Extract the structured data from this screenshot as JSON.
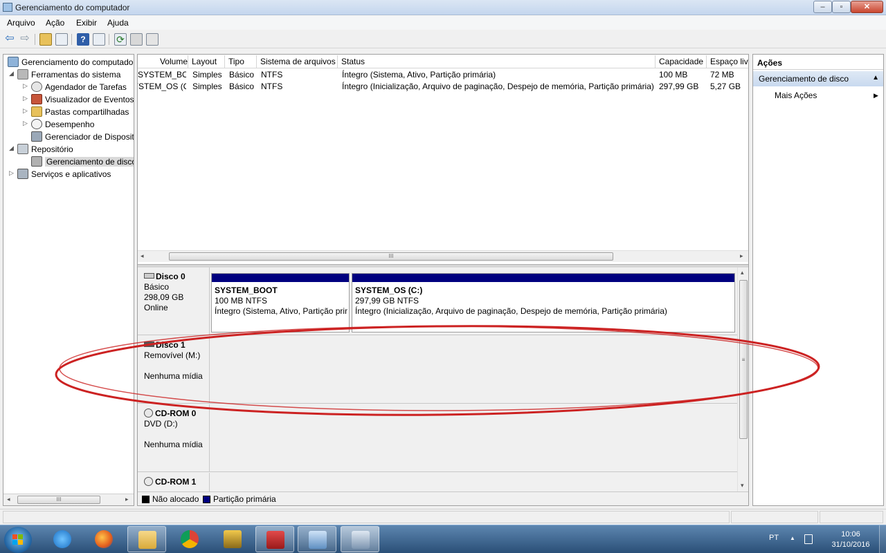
{
  "window": {
    "title": "Gerenciamento do computador",
    "minimize_glyph": "‒",
    "maximize_glyph": "▫",
    "close_glyph": "✕"
  },
  "menu": [
    "Arquivo",
    "Ação",
    "Exibir",
    "Ajuda"
  ],
  "toolbar": {
    "back_glyph": "⇦",
    "forward_glyph": "⇨",
    "help_glyph": "?",
    "refresh_glyph": "⟳"
  },
  "tree": {
    "root": "Gerenciamento do computador (Local)",
    "system_tools": "Ferramentas do sistema",
    "task_scheduler": "Agendador de Tarefas",
    "event_viewer": "Visualizador de Eventos",
    "shared_folders": "Pastas compartilhadas",
    "performance": "Desempenho",
    "device_manager": "Gerenciador de Dispositivos",
    "storage": "Repositório",
    "disk_management": "Gerenciamento de disco",
    "services_apps": "Serviços e aplicativos",
    "expanded_glyph": "◢",
    "collapsed_glyph": "▷"
  },
  "volume_list": {
    "columns": [
      "Volume",
      "Layout",
      "Tipo",
      "Sistema de arquivos",
      "Status",
      "Capacidade",
      "Espaço livre"
    ],
    "rows": [
      [
        "SYSTEM_BOOT",
        "Simples",
        "Básico",
        "NTFS",
        "Íntegro (Sistema, Ativo, Partição primária)",
        "100 MB",
        "72 MB"
      ],
      [
        "SYSTEM_OS (C:)",
        "Simples",
        "Básico",
        "NTFS",
        "Íntegro (Inicialização, Arquivo de paginação, Despejo de memória, Partição primária)",
        "297,99 GB",
        "5,27 GB"
      ]
    ]
  },
  "scroll": {
    "grip": "III",
    "vgrip": "≡",
    "left_arrow": "◂",
    "right_arrow": "▸",
    "up_arrow": "▴",
    "down_arrow": "▾"
  },
  "disks": [
    {
      "name": "Disco 0",
      "line1": "Básico",
      "line2": "298,09 GB",
      "line3": "Online",
      "partitions": [
        {
          "name": "SYSTEM_BOOT",
          "size": "100 MB NTFS",
          "status": "Íntegro (Sistema, Ativo, Partição primária)"
        },
        {
          "name": "SYSTEM_OS  (C:)",
          "size": "297,99 GB NTFS",
          "status": "Íntegro (Inicialização, Arquivo de paginação, Despejo de memória, Partição primária)"
        }
      ]
    },
    {
      "name": "Disco 1",
      "line1": "Removível (M:)",
      "line3": "Nenhuma mídia"
    },
    {
      "name": "CD-ROM 0",
      "line1": "DVD (D:)",
      "line3": "Nenhuma mídia"
    },
    {
      "name": "CD-ROM 1"
    }
  ],
  "legend": [
    {
      "label": "Não alocado",
      "color": "#000000"
    },
    {
      "label": "Partição primária",
      "color": "#00007f"
    }
  ],
  "actions": {
    "title": "Ações",
    "section": "Gerenciamento de disco",
    "section_arrow": "▲",
    "more": "Mais Ações",
    "more_arrow": "▶"
  },
  "annotation": {
    "color": "#cc2222"
  },
  "taskbar": {
    "language": "PT",
    "tray_arrow": "▲",
    "time": "10:06",
    "date": "31/10/2016",
    "apps": [
      "internet-explorer",
      "firefox",
      "file-explorer",
      "chrome",
      "tool-app",
      "toolbox-app",
      "control-panel",
      "computer-management"
    ]
  }
}
